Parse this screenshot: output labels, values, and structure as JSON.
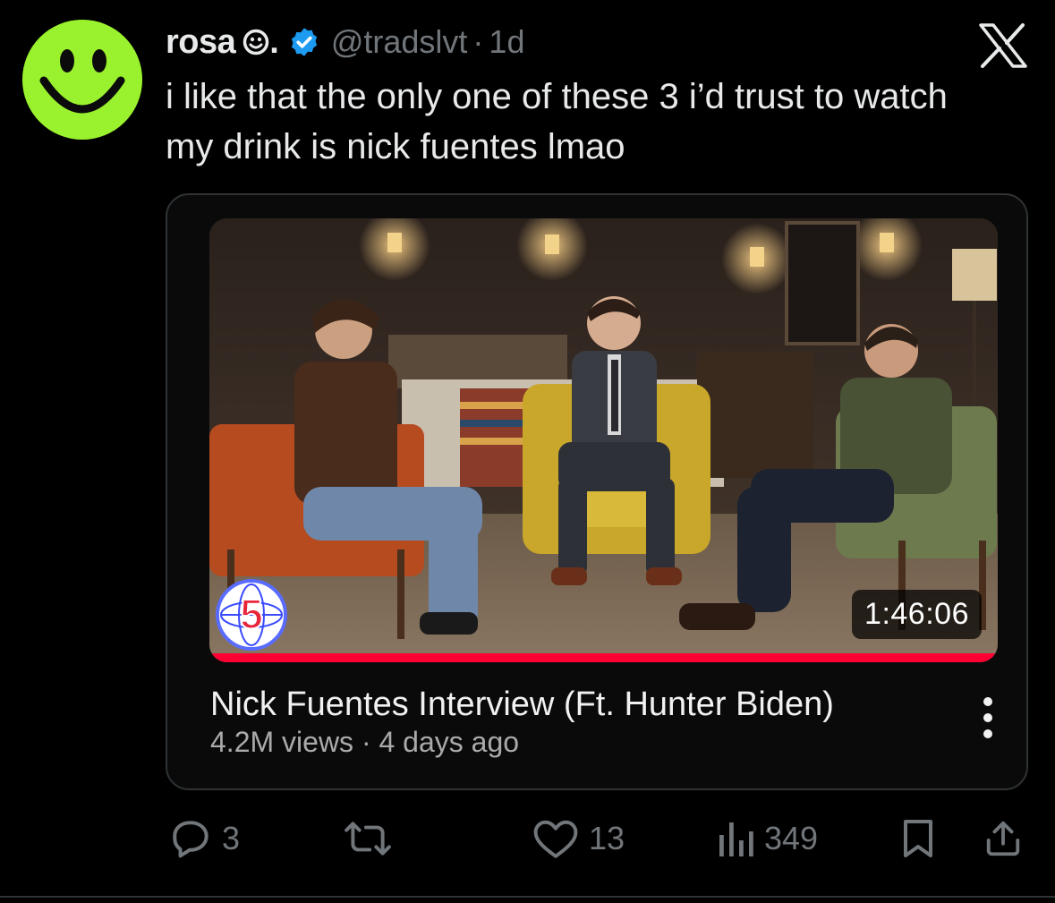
{
  "tweet": {
    "display_name": "rosa",
    "display_name_suffix": ".",
    "handle": "@tradslvt",
    "separator": "·",
    "time": "1d",
    "text": "i like that the only one of these 3 i’d trust to watch my drink is nick fuentes lmao",
    "avatar_icon": "smiley-face-icon",
    "avatar_color": "#9af22e",
    "verified_color": "#1d9bf0"
  },
  "video_card": {
    "title": "Nick Fuentes Interview (Ft. Hunter Biden)",
    "views": "4.2M views",
    "meta_separator": "·",
    "age": "4 days ago",
    "duration": "1:46:06",
    "channel_logo_text": "5",
    "progress_fraction": 1.0,
    "progress_color": "#ff0033"
  },
  "actions": {
    "replies": "3",
    "reposts": "",
    "likes": "13",
    "views": "349"
  },
  "icons": {
    "reply": "reply-icon",
    "repost": "repost-icon",
    "like": "heart-icon",
    "views": "views-bar-chart-icon",
    "bookmark": "bookmark-icon",
    "share": "share-icon",
    "platform": "x-logo-icon",
    "more": "more-vertical-icon"
  }
}
